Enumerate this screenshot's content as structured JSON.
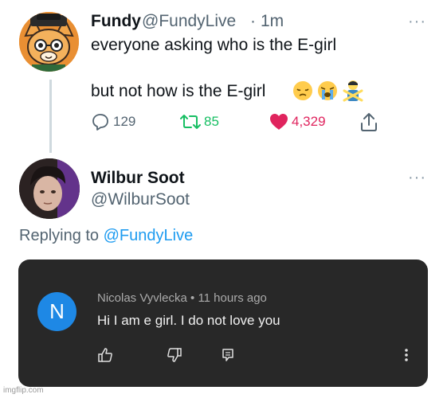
{
  "tweet1": {
    "author_name": "Fundy",
    "author_handle": "@FundyLive",
    "separator": "·",
    "time": "1m",
    "line1": "everyone asking who is the E-girl",
    "line2": "but not how is the E-girl",
    "emojis": [
      "pensive-face",
      "loudly-crying-face",
      "person-gesturing-no"
    ],
    "replies": "129",
    "retweets": "85",
    "likes": "4,329",
    "more_label": "···"
  },
  "tweet2": {
    "author_name": "Wilbur Soot",
    "author_handle": "@WilburSoot",
    "more_label": "···",
    "replying_prefix": "Replying to ",
    "replying_to": "@FundyLive"
  },
  "yt_comment": {
    "avatar_letter": "N",
    "author": "Nicolas Vyvlecka",
    "separator": "•",
    "time_ago": "11 hours ago",
    "text": "Hi I am e girl. I do not love you"
  },
  "watermark": "imgflip.com",
  "colors": {
    "retweet_green": "#17bf63",
    "like_red": "#e0245e",
    "link_blue": "#1d9bf0",
    "yt_card_bg": "#282828",
    "yt_avatar_blue": "#1e88e5"
  }
}
